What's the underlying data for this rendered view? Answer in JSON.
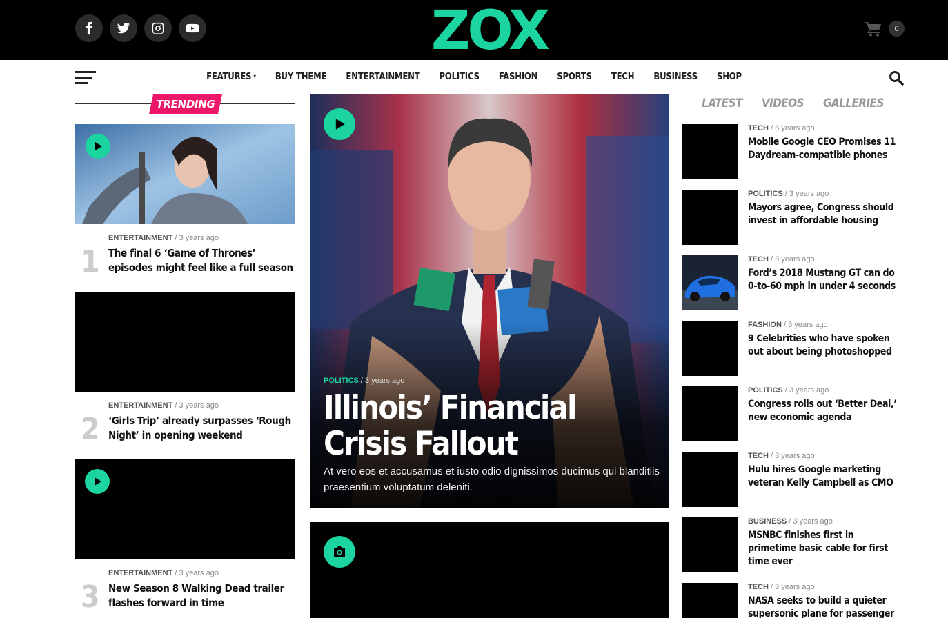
{
  "brand": {
    "logo_text": "ZOX",
    "accent": "#1bd4a0",
    "trending_color": "#ec1768"
  },
  "header": {
    "social": [
      {
        "icon": "facebook-icon"
      },
      {
        "icon": "twitter-icon"
      },
      {
        "icon": "instagram-icon"
      },
      {
        "icon": "youtube-icon"
      }
    ],
    "cart_count": "0"
  },
  "nav": {
    "items": [
      "FEATURES",
      "BUY THEME",
      "ENTERTAINMENT",
      "POLITICS",
      "FASHION",
      "SPORTS",
      "TECH",
      "BUSINESS",
      "SHOP"
    ]
  },
  "trending": {
    "label": "TRENDING",
    "items": [
      {
        "num": "1",
        "category": "ENTERTAINMENT",
        "time": "3 years ago",
        "title": "The final 6 ‘Game of Thrones’ episodes might feel like a full season"
      },
      {
        "num": "2",
        "category": "ENTERTAINMENT",
        "time": "3 years ago",
        "title": "‘Girls Trip’ already surpasses ‘Rough Night’ in opening weekend"
      },
      {
        "num": "3",
        "category": "ENTERTAINMENT",
        "time": "3 years ago",
        "title": "New Season 8 Walking Dead trailer flashes forward in time"
      }
    ]
  },
  "feature": {
    "category": "POLITICS",
    "time": "3 years ago",
    "title": "Illinois’ Financial Crisis Fallout",
    "excerpt": "At vero eos et accusamus et iusto odio dignissimos ducimus qui blanditiis praesentium voluptatum deleniti."
  },
  "sidebar": {
    "tabs": [
      "LATEST",
      "VIDEOS",
      "GALLERIES"
    ],
    "items": [
      {
        "category": "TECH",
        "time": "3 years ago",
        "title": "Mobile Google CEO Promises 11 Daydream-compatible phones"
      },
      {
        "category": "POLITICS",
        "time": "3 years ago",
        "title": "Mayors agree, Congress should invest in affordable housing"
      },
      {
        "category": "TECH",
        "time": "3 years ago",
        "title": "Ford’s 2018 Mustang GT can do 0-to-60 mph in under 4 seconds"
      },
      {
        "category": "FASHION",
        "time": "3 years ago",
        "title": "9 Celebrities who have spoken out about being photoshopped"
      },
      {
        "category": "POLITICS",
        "time": "3 years ago",
        "title": "Congress rolls out ‘Better Deal,’ new economic agenda"
      },
      {
        "category": "TECH",
        "time": "3 years ago",
        "title": "Hulu hires Google marketing veteran Kelly Campbell as CMO"
      },
      {
        "category": "BUSINESS",
        "time": "3 years ago",
        "title": "MSNBC finishes first in primetime basic cable for first time ever"
      },
      {
        "category": "TECH",
        "time": "3 years ago",
        "title": "NASA seeks to build a quieter supersonic plane for passenger"
      }
    ]
  }
}
